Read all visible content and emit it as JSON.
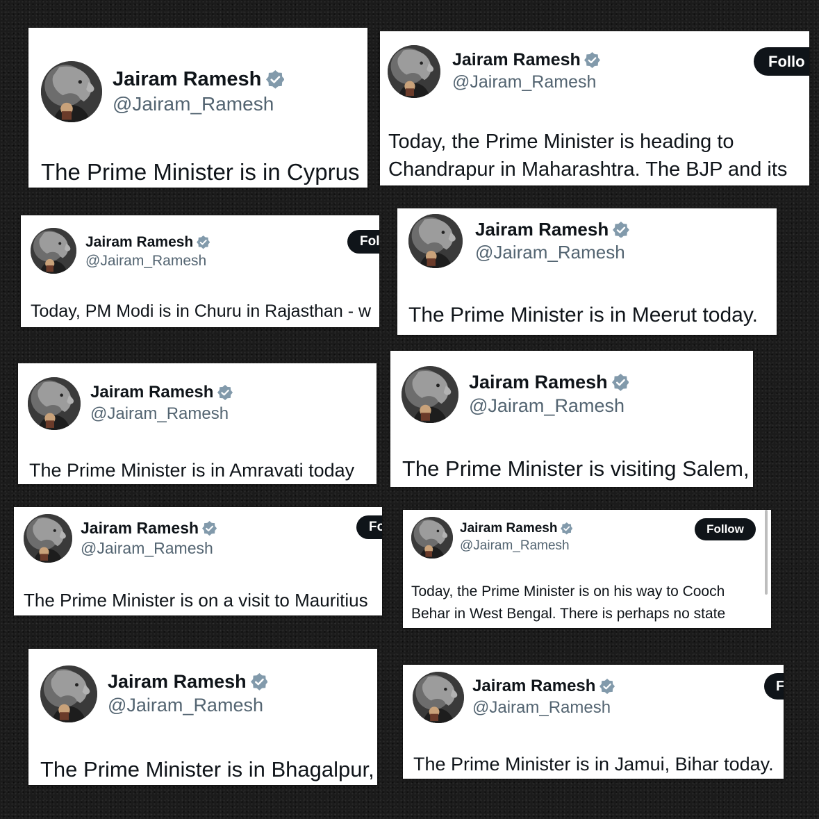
{
  "colors": {
    "background": "#1b1b1b",
    "card": "#ffffff",
    "name_text": "#0f1419",
    "handle_text": "#536471",
    "verified_badge": "#829aab",
    "follow_button": "#0f1419"
  },
  "cards": [
    {
      "name": "Jairam Ramesh",
      "handle": "@Jairam_Ramesh",
      "text": "The Prime Minister is in Cyprus",
      "follow": ""
    },
    {
      "name": "Jairam Ramesh",
      "handle": "@Jairam_Ramesh",
      "text_lines": [
        "Today, the Prime Minister is heading to",
        "Chandrapur in Maharashtra. The BJP and its"
      ],
      "follow": "Follo"
    },
    {
      "name": "Jairam Ramesh",
      "handle": "@Jairam_Ramesh",
      "text": "Today, PM Modi is in Churu in Rajasthan - w",
      "follow": "Fol"
    },
    {
      "name": "Jairam Ramesh",
      "handle": "@Jairam_Ramesh",
      "text": "The Prime Minister is in Meerut today.",
      "follow": ""
    },
    {
      "name": "Jairam Ramesh",
      "handle": "@Jairam_Ramesh",
      "text": "The Prime Minister is in Amravati today",
      "follow": ""
    },
    {
      "name": "Jairam Ramesh",
      "handle": "@Jairam_Ramesh",
      "text": "The Prime Minister is visiting Salem,",
      "follow": ""
    },
    {
      "name": "Jairam Ramesh",
      "handle": "@Jairam_Ramesh",
      "text": "The Prime Minister is on a visit to Mauritius",
      "follow": "Fo"
    },
    {
      "name": "Jairam Ramesh",
      "handle": "@Jairam_Ramesh",
      "text_lines": [
        "Today, the Prime Minister is on his way to Cooch",
        "Behar in West Bengal. There is perhaps no state"
      ],
      "follow": "Follow"
    },
    {
      "name": "Jairam Ramesh",
      "handle": "@Jairam_Ramesh",
      "text": "The Prime Minister is in Bhagalpur,",
      "follow": ""
    },
    {
      "name": "Jairam Ramesh",
      "handle": "@Jairam_Ramesh",
      "text": "The Prime Minister is in Jamui, Bihar today.",
      "follow": "F"
    }
  ]
}
